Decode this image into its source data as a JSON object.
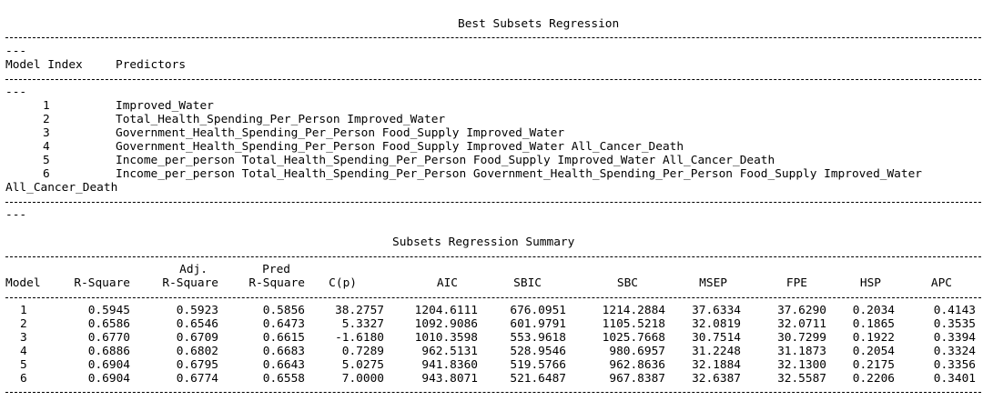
{
  "best_subsets": {
    "title": "Best Subsets Regression",
    "rule_tail": "---",
    "header": {
      "model_index": "Model Index",
      "predictors": "Predictors"
    },
    "rows": [
      {
        "index": "1",
        "predictors": "Improved_Water"
      },
      {
        "index": "2",
        "predictors": "Total_Health_Spending_Per_Person Improved_Water"
      },
      {
        "index": "3",
        "predictors": "Government_Health_Spending_Per_Person Food_Supply Improved_Water"
      },
      {
        "index": "4",
        "predictors": "Government_Health_Spending_Per_Person Food_Supply Improved_Water All_Cancer_Death"
      },
      {
        "index": "5",
        "predictors": "Income_per_person Total_Health_Spending_Per_Person Food_Supply Improved_Water All_Cancer_Death"
      },
      {
        "index": "6",
        "predictors": "Income_per_person Total_Health_Spending_Per_Person Government_Health_Spending_Per_Person Food_Supply Improved_Water",
        "continuation": "All_Cancer_Death"
      }
    ]
  },
  "summary": {
    "title": "Subsets Regression Summary",
    "headers": {
      "model": "Model",
      "rsq": "R-Square",
      "adj_top": "Adj.",
      "adj_bottom": "R-Square",
      "pred_top": "Pred",
      "pred_bottom": "R-Square",
      "cp": "C(p)",
      "aic": "AIC",
      "sbic": "SBIC",
      "sbc": "SBC",
      "msep": "MSEP",
      "fpe": "FPE",
      "hsp": "HSP",
      "apc": "APC"
    },
    "rows": [
      {
        "model": "1",
        "rsq": "0.5945",
        "adj": "0.5923",
        "pred": "0.5856",
        "cp": "38.2757",
        "aic": "1204.6111",
        "sbic": "676.0951",
        "sbc": "1214.2884",
        "msep": "37.6334",
        "fpe": "37.6290",
        "hsp": "0.2034",
        "apc": "0.4143"
      },
      {
        "model": "2",
        "rsq": "0.6586",
        "adj": "0.6546",
        "pred": "0.6473",
        "cp": "5.3327",
        "aic": "1092.9086",
        "sbic": "601.9791",
        "sbc": "1105.5218",
        "msep": "32.0819",
        "fpe": "32.0711",
        "hsp": "0.1865",
        "apc": "0.3535"
      },
      {
        "model": "3",
        "rsq": "0.6770",
        "adj": "0.6709",
        "pred": "0.6615",
        "cp": "-1.6180",
        "aic": "1010.3598",
        "sbic": "553.9618",
        "sbc": "1025.7668",
        "msep": "30.7514",
        "fpe": "30.7299",
        "hsp": "0.1922",
        "apc": "0.3394"
      },
      {
        "model": "4",
        "rsq": "0.6886",
        "adj": "0.6802",
        "pred": "0.6683",
        "cp": "0.7289",
        "aic": "962.5131",
        "sbic": "528.9546",
        "sbc": "980.6957",
        "msep": "31.2248",
        "fpe": "31.1873",
        "hsp": "0.2054",
        "apc": "0.3324"
      },
      {
        "model": "5",
        "rsq": "0.6904",
        "adj": "0.6795",
        "pred": "0.6643",
        "cp": "5.0275",
        "aic": "941.8360",
        "sbic": "519.5766",
        "sbc": "962.8636",
        "msep": "32.1884",
        "fpe": "32.1300",
        "hsp": "0.2175",
        "apc": "0.3356"
      },
      {
        "model": "6",
        "rsq": "0.6904",
        "adj": "0.6774",
        "pred": "0.6558",
        "cp": "7.0000",
        "aic": "943.8071",
        "sbic": "521.6487",
        "sbc": "967.8387",
        "msep": "32.6387",
        "fpe": "32.5587",
        "hsp": "0.2206",
        "apc": "0.3401"
      }
    ]
  }
}
